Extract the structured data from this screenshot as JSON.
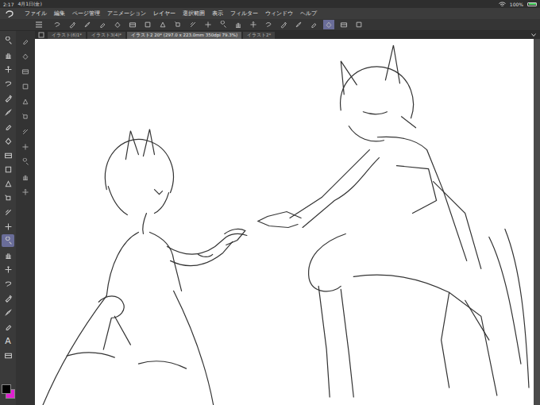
{
  "status_bar": {
    "time": "2:17",
    "date": "4月1日(金)",
    "battery": "100%",
    "battery_level": 1.0
  },
  "menu": [
    "ファイル",
    "編集",
    "ページ管理",
    "アニメーション",
    "レイヤー",
    "選択範囲",
    "表示",
    "フィルター",
    "ウィンドウ",
    "ヘルプ"
  ],
  "command_bar": [
    {
      "selected": false
    },
    {
      "selected": false
    },
    {
      "selected": false
    },
    {
      "selected": false
    },
    {
      "selected": false
    },
    {
      "selected": false
    },
    {
      "selected": false
    },
    {
      "selected": false
    },
    {
      "selected": false
    },
    {
      "selected": false
    },
    {
      "selected": false
    },
    {
      "selected": false
    },
    {
      "selected": false
    },
    {
      "selected": false
    },
    {
      "selected": false
    },
    {
      "selected": false
    },
    {
      "selected": false
    },
    {
      "selected": false
    },
    {
      "selected": true
    },
    {
      "selected": false
    },
    {
      "selected": false
    }
  ],
  "tabs": [
    {
      "label": "イラスト(6)1*",
      "selected": false
    },
    {
      "label": "イラスト3(4)*",
      "selected": false
    },
    {
      "label": "イラスト2 20* (297.0 x 223.0mm 350dpi 79.3%)",
      "selected": true
    },
    {
      "label": "イラスト2*",
      "selected": false
    }
  ],
  "tools": [
    {
      "kind": "icon",
      "selected": false
    },
    {
      "kind": "icon",
      "selected": false
    },
    {
      "kind": "icon",
      "selected": false
    },
    {
      "kind": "icon",
      "selected": false
    },
    {
      "kind": "icon",
      "selected": false
    },
    {
      "kind": "icon",
      "selected": false
    },
    {
      "kind": "icon",
      "selected": false
    },
    {
      "kind": "icon",
      "selected": false
    },
    {
      "kind": "icon",
      "selected": false
    },
    {
      "kind": "icon",
      "selected": false
    },
    {
      "kind": "icon",
      "selected": false
    },
    {
      "kind": "icon",
      "selected": false
    },
    {
      "kind": "icon",
      "selected": false
    },
    {
      "kind": "icon",
      "selected": false
    },
    {
      "kind": "icon",
      "selected": true
    },
    {
      "kind": "icon",
      "selected": false
    },
    {
      "kind": "icon",
      "selected": false
    },
    {
      "kind": "icon",
      "selected": false
    },
    {
      "kind": "icon",
      "selected": false
    },
    {
      "kind": "icon",
      "selected": false
    },
    {
      "kind": "icon",
      "selected": false
    },
    {
      "kind": "text",
      "glyph": "A",
      "selected": false
    },
    {
      "kind": "icon",
      "selected": false
    }
  ],
  "sub_tools": [
    {
      "selected": false
    },
    {
      "selected": false
    },
    {
      "selected": false
    },
    {
      "selected": false
    },
    {
      "selected": false
    },
    {
      "selected": false
    },
    {
      "selected": false
    },
    {
      "selected": false
    },
    {
      "selected": false
    },
    {
      "selected": false
    },
    {
      "selected": false
    }
  ],
  "color_swatches": [
    {
      "name": "main",
      "color": "#000000"
    },
    {
      "name": "sub",
      "color": "#e020d0"
    }
  ]
}
